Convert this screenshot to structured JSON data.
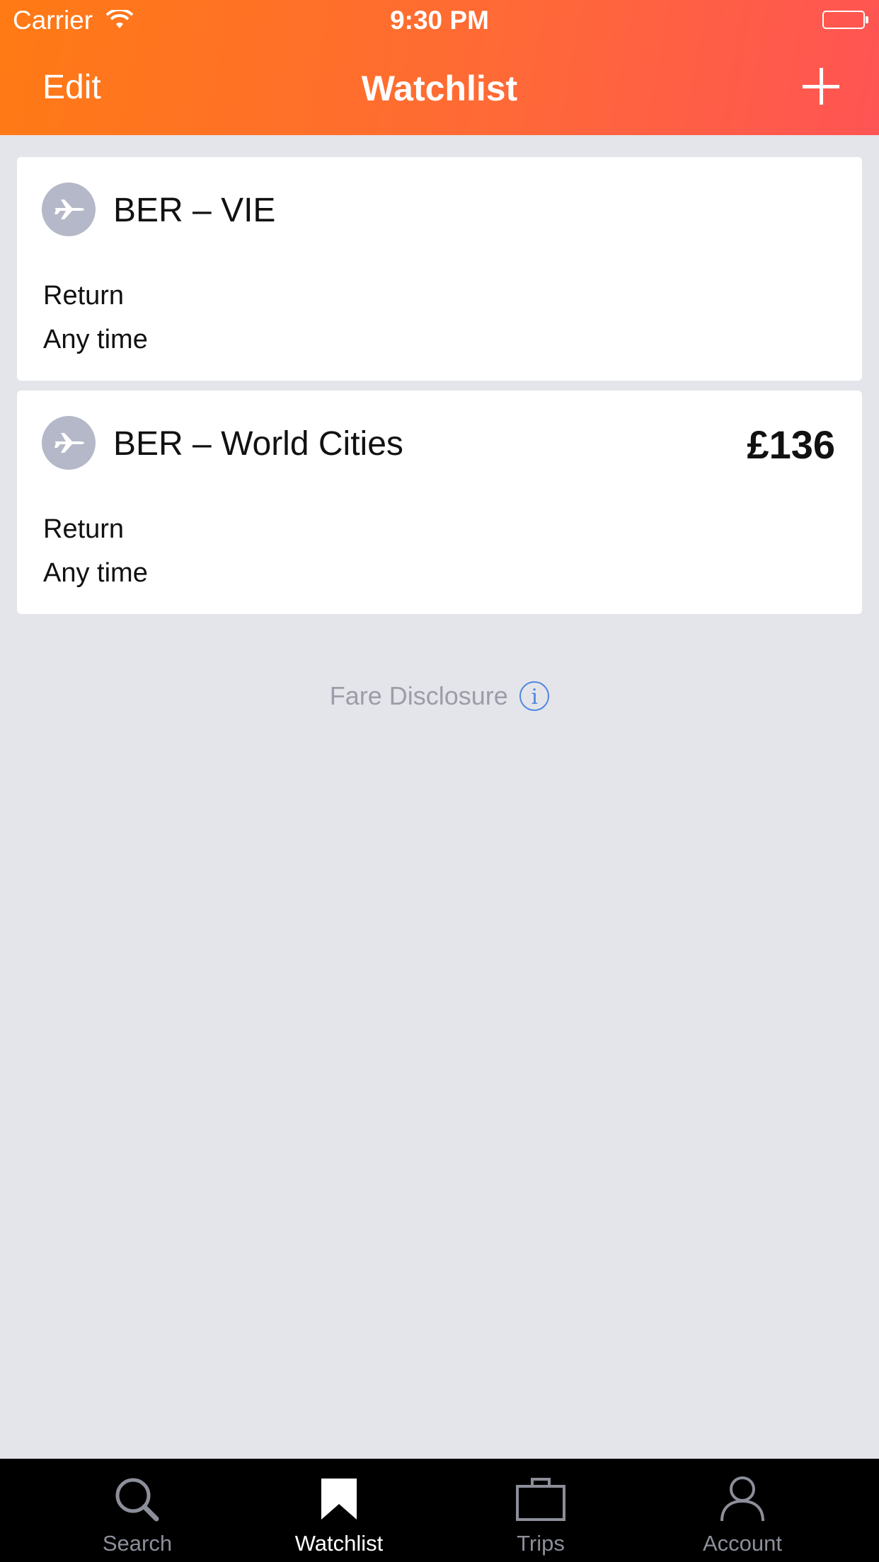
{
  "status_bar": {
    "carrier": "Carrier",
    "time": "9:30 PM"
  },
  "nav": {
    "edit_label": "Edit",
    "title": "Watchlist",
    "add_icon": "plus-icon"
  },
  "watchlist": [
    {
      "route": "BER – VIE",
      "price": "",
      "trip_type": "Return",
      "time": "Any time",
      "icon": "airplane-icon"
    },
    {
      "route": "BER – World Cities",
      "price": "£136",
      "trip_type": "Return",
      "time": "Any time",
      "icon": "airplane-icon"
    }
  ],
  "fare_disclosure": {
    "label": "Fare Disclosure",
    "icon": "info-icon"
  },
  "tabs": [
    {
      "label": "Search",
      "icon": "search-icon",
      "active": false
    },
    {
      "label": "Watchlist",
      "icon": "bookmark-icon",
      "active": true
    },
    {
      "label": "Trips",
      "icon": "briefcase-icon",
      "active": false
    },
    {
      "label": "Account",
      "icon": "person-icon",
      "active": false
    }
  ],
  "colors": {
    "header_start": "#ff7a14",
    "header_end": "#ff5454",
    "background": "#e4e5ea",
    "info_blue": "#4f86e0",
    "tab_inactive": "#8c8e99"
  }
}
